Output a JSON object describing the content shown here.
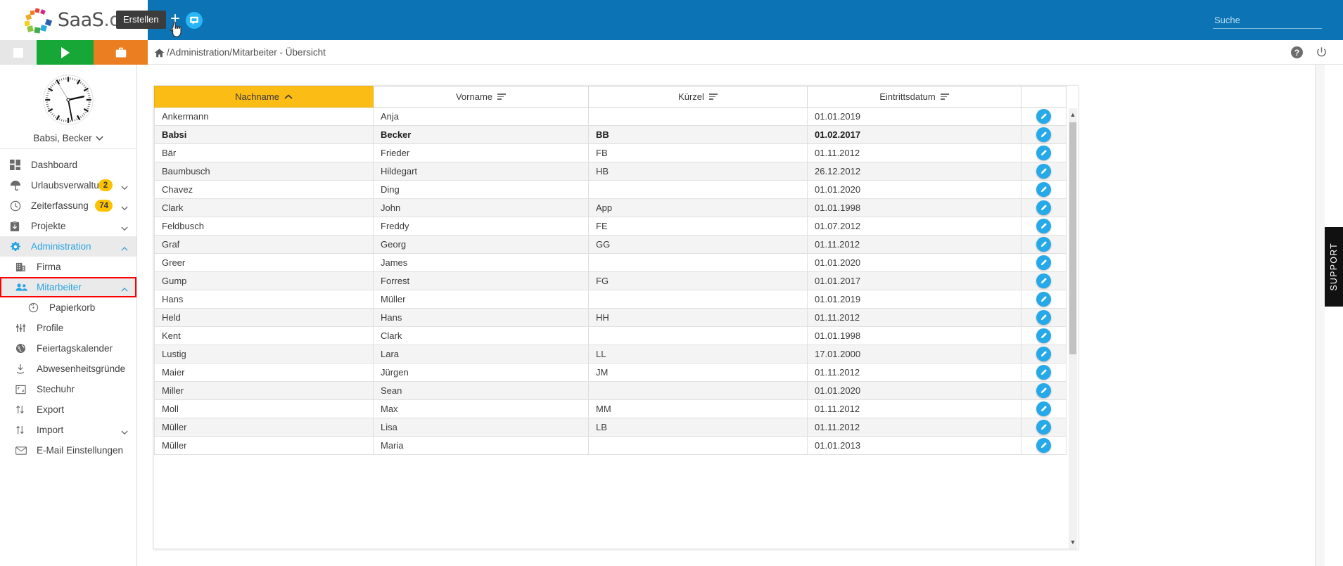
{
  "brand": {
    "name": "SaaS",
    "suffix": ".de",
    "logo_icon": "saas-circle-logo"
  },
  "topbar": {
    "tooltip": "Erstellen",
    "create_icon": "plus-icon",
    "chat_icon": "chat-bubble-icon",
    "cursor_icon": "pointer-hand-cursor",
    "search_placeholder": "Suche",
    "search_value": ""
  },
  "quickbar": {
    "stop_icon": "stop-square-icon",
    "play_icon": "play-triangle-icon",
    "project_icon": "briefcase-icon"
  },
  "breadcrumb": {
    "home_icon": "home-icon",
    "path": "/Administration/Mitarbeiter - Übersicht"
  },
  "header_actions": {
    "help_icon": "question-mark-icon",
    "help_label": "?",
    "power_icon": "power-icon"
  },
  "profile": {
    "clock_icon": "analog-clock",
    "clock_time": "3:30",
    "name": "Babsi, Becker",
    "chevron_icon": "chevron-down-icon"
  },
  "sidebar": {
    "items": [
      {
        "label": "Dashboard",
        "icon": "dashboard-grid-icon",
        "level": 0,
        "active": false,
        "badge": null,
        "chevron": null
      },
      {
        "label": "Urlaubsverwaltung",
        "icon": "umbrella-icon",
        "level": 0,
        "active": false,
        "badge": "2",
        "chevron": "chevron-down-icon"
      },
      {
        "label": "Zeiterfassung",
        "icon": "clock-icon",
        "level": 0,
        "active": false,
        "badge": "74",
        "chevron": "chevron-down-icon"
      },
      {
        "label": "Projekte",
        "icon": "clipboard-icon",
        "level": 0,
        "active": false,
        "badge": null,
        "chevron": "chevron-down-icon"
      },
      {
        "label": "Administration",
        "icon": "gear-icon",
        "level": 0,
        "active": true,
        "badge": null,
        "chevron": "chevron-up-icon"
      },
      {
        "label": "Firma",
        "icon": "building-icon",
        "level": 1,
        "active": false,
        "badge": null,
        "chevron": null
      },
      {
        "label": "Mitarbeiter",
        "icon": "people-icon",
        "level": 1,
        "active": true,
        "badge": null,
        "chevron": "chevron-up-icon",
        "highlight": true
      },
      {
        "label": "Papierkorb",
        "icon": "restore-trash-icon",
        "level": 2,
        "active": false,
        "badge": null,
        "chevron": null
      },
      {
        "label": "Profile",
        "icon": "sliders-icon",
        "level": 1,
        "active": false,
        "badge": null,
        "chevron": null
      },
      {
        "label": "Feiertagskalender",
        "icon": "globe-icon",
        "level": 1,
        "active": false,
        "badge": null,
        "chevron": null
      },
      {
        "label": "Abwesenheitsgründe",
        "icon": "download-icon",
        "level": 1,
        "active": false,
        "badge": null,
        "chevron": null
      },
      {
        "label": "Stechuhr",
        "icon": "timeclock-icon",
        "level": 1,
        "active": false,
        "badge": null,
        "chevron": null
      },
      {
        "label": "Export",
        "icon": "transfer-icon",
        "level": 1,
        "active": false,
        "badge": null,
        "chevron": null
      },
      {
        "label": "Import",
        "icon": "transfer-icon",
        "level": 1,
        "active": false,
        "badge": null,
        "chevron": "chevron-down-icon"
      },
      {
        "label": "E-Mail Einstellungen",
        "icon": "envelope-icon",
        "level": 1,
        "active": false,
        "badge": null,
        "chevron": null
      }
    ]
  },
  "table": {
    "columns": [
      {
        "label": "Nachname",
        "sorted": true,
        "sort_dir": "asc",
        "sort_icon": "chevron-up-icon"
      },
      {
        "label": "Vorname",
        "sorted": false,
        "sort_icon": "sort-lines-icon"
      },
      {
        "label": "Kürzel",
        "sorted": false,
        "sort_icon": "sort-lines-icon"
      },
      {
        "label": "Eintrittsdatum",
        "sorted": false,
        "sort_icon": "sort-lines-icon"
      },
      {
        "label": "",
        "sorted": false,
        "sort_icon": null
      }
    ],
    "edit_icon": "pencil-icon",
    "rows": [
      {
        "nachname": "Ankermann",
        "vorname": "Anja",
        "kuerzel": "",
        "eintritt": "01.01.2019",
        "bold": false
      },
      {
        "nachname": "Babsi",
        "vorname": "Becker",
        "kuerzel": "BB",
        "eintritt": "01.02.2017",
        "bold": true
      },
      {
        "nachname": "Bär",
        "vorname": "Frieder",
        "kuerzel": "FB",
        "eintritt": "01.11.2012",
        "bold": false
      },
      {
        "nachname": "Baumbusch",
        "vorname": "Hildegart",
        "kuerzel": "HB",
        "eintritt": "26.12.2012",
        "bold": false
      },
      {
        "nachname": "Chavez",
        "vorname": "Ding",
        "kuerzel": "",
        "eintritt": "01.01.2020",
        "bold": false
      },
      {
        "nachname": "Clark",
        "vorname": "John",
        "kuerzel": "App",
        "eintritt": "01.01.1998",
        "bold": false
      },
      {
        "nachname": "Feldbusch",
        "vorname": "Freddy",
        "kuerzel": "FE",
        "eintritt": "01.07.2012",
        "bold": false
      },
      {
        "nachname": "Graf",
        "vorname": "Georg",
        "kuerzel": "GG",
        "eintritt": "01.11.2012",
        "bold": false
      },
      {
        "nachname": "Greer",
        "vorname": "James",
        "kuerzel": "",
        "eintritt": "01.01.2020",
        "bold": false
      },
      {
        "nachname": "Gump",
        "vorname": "Forrest",
        "kuerzel": "FG",
        "eintritt": "01.01.2017",
        "bold": false
      },
      {
        "nachname": "Hans",
        "vorname": "Müller",
        "kuerzel": "",
        "eintritt": "01.01.2019",
        "bold": false
      },
      {
        "nachname": "Held",
        "vorname": "Hans",
        "kuerzel": "HH",
        "eintritt": "01.11.2012",
        "bold": false
      },
      {
        "nachname": "Kent",
        "vorname": "Clark",
        "kuerzel": "",
        "eintritt": "01.01.1998",
        "bold": false
      },
      {
        "nachname": "Lustig",
        "vorname": "Lara",
        "kuerzel": "LL",
        "eintritt": "17.01.2000",
        "bold": false
      },
      {
        "nachname": "Maier",
        "vorname": "Jürgen",
        "kuerzel": "JM",
        "eintritt": "01.11.2012",
        "bold": false
      },
      {
        "nachname": "Miller",
        "vorname": "Sean",
        "kuerzel": "",
        "eintritt": "01.01.2020",
        "bold": false
      },
      {
        "nachname": "Moll",
        "vorname": "Max",
        "kuerzel": "MM",
        "eintritt": "01.11.2012",
        "bold": false
      },
      {
        "nachname": "Müller",
        "vorname": "Lisa",
        "kuerzel": "LB",
        "eintritt": "01.11.2012",
        "bold": false
      },
      {
        "nachname": "Müller",
        "vorname": "Maria",
        "kuerzel": "",
        "eintritt": "01.01.2013",
        "bold": false
      }
    ]
  },
  "support": {
    "label": "SUPPORT"
  },
  "colors": {
    "topbar_blue": "#0c74b5",
    "accent_blue": "#29a3e2",
    "sort_amber": "#fcbc16",
    "badge_yellow": "#fcc200",
    "green": "#17a737",
    "orange": "#ea7e20",
    "highlight_red": "#ff0000"
  }
}
